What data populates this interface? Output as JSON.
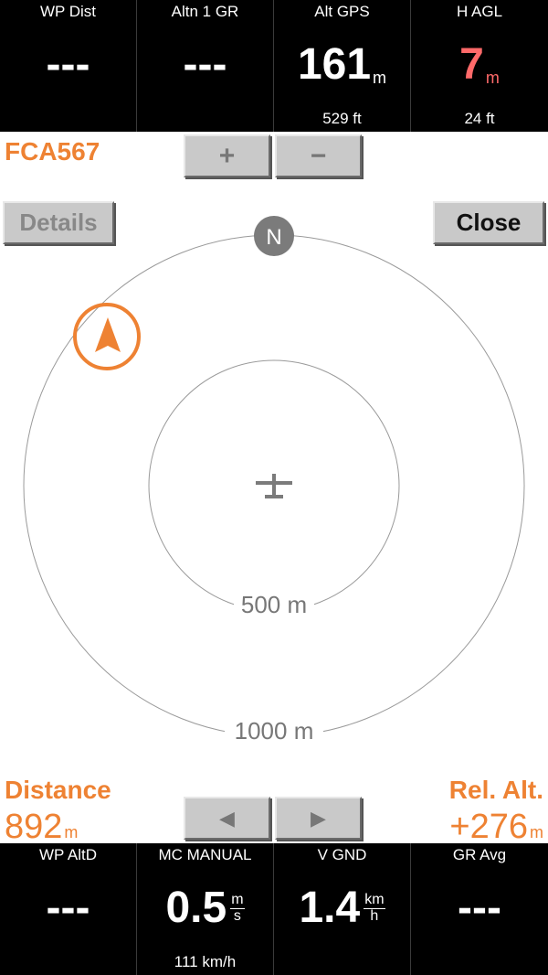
{
  "top_bar": [
    {
      "title": "WP Dist",
      "value": "---",
      "unit": "",
      "comment": ""
    },
    {
      "title": "Altn 1 GR",
      "value": "---",
      "unit": "",
      "comment": ""
    },
    {
      "title": "Alt GPS",
      "value": "161",
      "unit": "m",
      "comment": "529 ft"
    },
    {
      "title": "H AGL",
      "value": "7",
      "unit": "m",
      "comment": "24 ft"
    }
  ],
  "target": {
    "callsign": "FCA567"
  },
  "buttons": {
    "zoom_in": "+",
    "zoom_out": "−",
    "details": "Details",
    "close": "Close",
    "prev": "◀",
    "next": "▶"
  },
  "radar": {
    "north_label": "N",
    "inner_ring_label": "500 m",
    "outer_ring_label": "1000 m"
  },
  "distance": {
    "title": "Distance",
    "value": "892",
    "unit": "m"
  },
  "relative_altitude": {
    "title": "Rel. Alt.",
    "value": "+276",
    "unit": "m"
  },
  "bottom_bar": [
    {
      "title": "WP AltD",
      "value": "---",
      "comment": ""
    },
    {
      "title": "MC MANUAL",
      "value": "0.5",
      "unit_top": "m",
      "unit_bottom": "s",
      "comment": "111 km/h"
    },
    {
      "title": "V GND",
      "value": "1.4",
      "unit_top": "km",
      "unit_bottom": "h",
      "comment": ""
    },
    {
      "title": "GR Avg",
      "value": "---",
      "comment": ""
    }
  ],
  "colors": {
    "accent": "#ee8233",
    "warning": "#ff6a6a",
    "bar_bg": "#000000"
  }
}
